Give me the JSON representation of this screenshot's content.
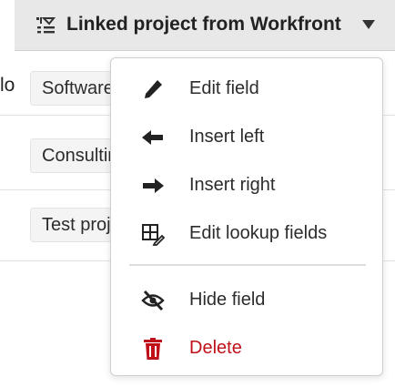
{
  "header": {
    "title": "Linked project from Workfront",
    "icon": "lookup-field-icon",
    "caret_icon": "caret-down-icon"
  },
  "grid": {
    "left_cell": "lo",
    "tags": [
      "Software",
      "Consulting",
      "Test project"
    ]
  },
  "menu": {
    "items": [
      {
        "label": "Edit field",
        "icon": "pencil-icon"
      },
      {
        "label": "Insert left",
        "icon": "arrow-left-icon"
      },
      {
        "label": "Insert right",
        "icon": "arrow-right-icon"
      },
      {
        "label": "Edit lookup fields",
        "icon": "lookup-edit-icon"
      },
      {
        "label": "Hide field",
        "icon": "eye-hidden-icon"
      },
      {
        "label": "Delete",
        "icon": "trash-icon"
      }
    ],
    "delete_color": "#c0101a"
  }
}
